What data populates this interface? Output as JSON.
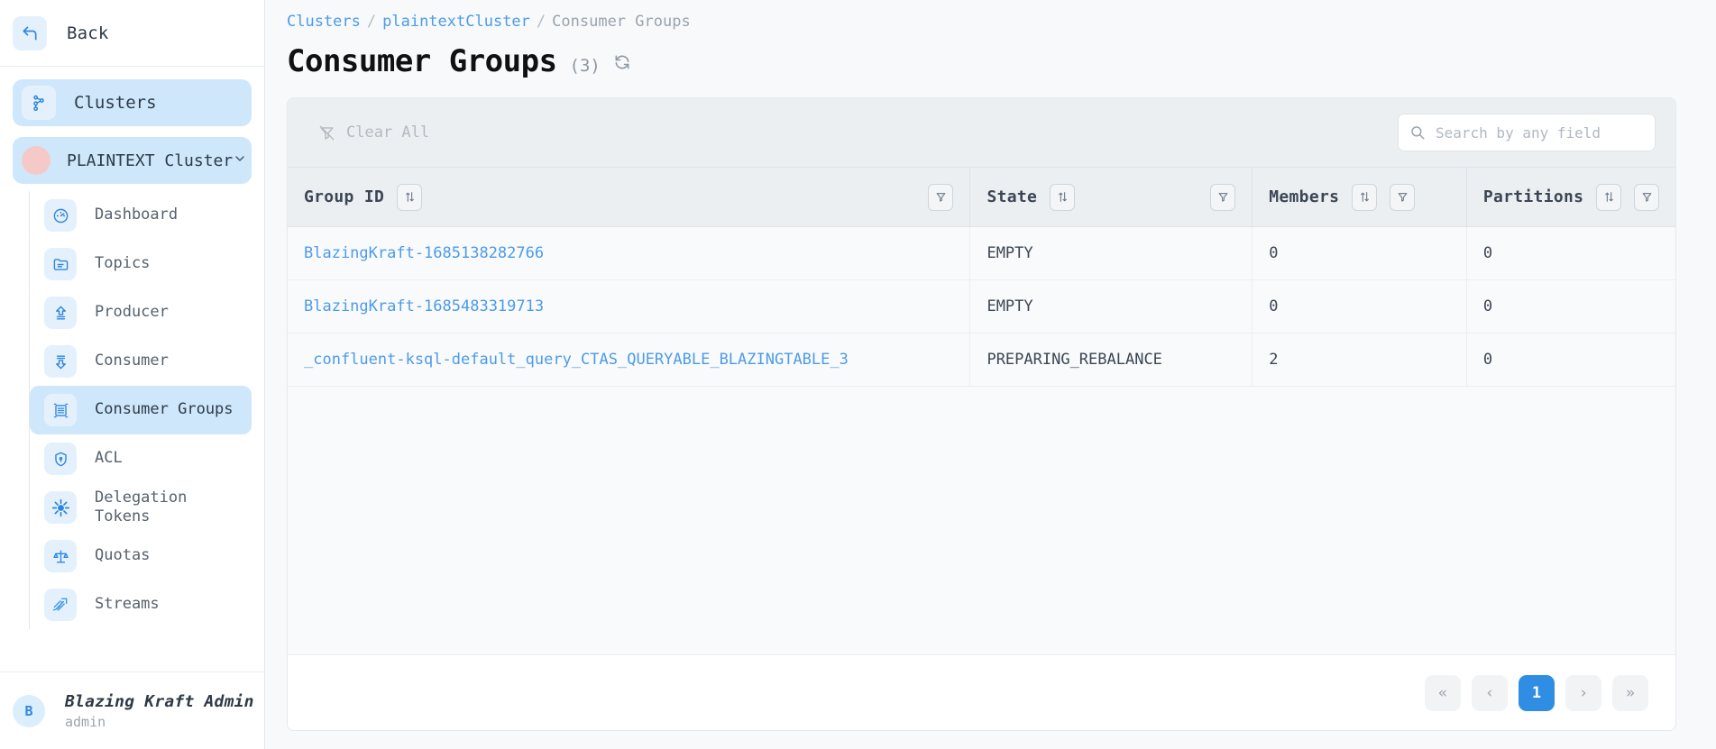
{
  "sidebar": {
    "back": {
      "label": "Back",
      "icon": "back-arrow-icon"
    },
    "clusters": {
      "label": "Clusters",
      "icon": "clusters-icon"
    },
    "cluster": {
      "label": "PLAINTEXT Cluster",
      "icon": "cluster-status-dot",
      "chevron": "⌄"
    },
    "items": [
      {
        "label": "Dashboard",
        "icon": "dashboard-icon",
        "active": false
      },
      {
        "label": "Topics",
        "icon": "topics-icon",
        "active": false
      },
      {
        "label": "Producer",
        "icon": "producer-icon",
        "active": false
      },
      {
        "label": "Consumer",
        "icon": "consumer-icon",
        "active": false
      },
      {
        "label": "Consumer Groups",
        "icon": "consumer-groups-icon",
        "active": true
      },
      {
        "label": "ACL",
        "icon": "shield-icon",
        "active": false
      },
      {
        "label": "Delegation\nTokens",
        "icon": "delegation-tokens-icon",
        "active": false
      },
      {
        "label": "Quotas",
        "icon": "scales-icon",
        "active": false
      },
      {
        "label": "Streams",
        "icon": "streams-icon",
        "active": false
      }
    ],
    "user": {
      "initial": "B",
      "name": "Blazing Kraft Admin",
      "role": "admin"
    }
  },
  "breadcrumb": {
    "items": [
      "Clusters",
      "plaintextCluster",
      "Consumer Groups"
    ],
    "separator": "/"
  },
  "header": {
    "title": "Consumer Groups",
    "count": "(3)",
    "refresh_icon": "refresh-icon"
  },
  "toolbar": {
    "clear_all_label": "Clear All",
    "clear_all_icon": "filter-off-icon",
    "search_icon": "search-icon",
    "search_placeholder": "Search by any field",
    "search_value": ""
  },
  "table": {
    "columns": [
      {
        "label": "Group ID",
        "sort_icon": "sort-icon",
        "filter_icon": "filter-icon",
        "has_spacer": true
      },
      {
        "label": "State",
        "sort_icon": "sort-icon",
        "filter_icon": "filter-icon",
        "has_spacer": true
      },
      {
        "label": "Members",
        "sort_icon": "sort-icon",
        "filter_icon": "filter-icon",
        "has_spacer": false
      },
      {
        "label": "Partitions",
        "sort_icon": "sort-icon",
        "filter_icon": "filter-icon",
        "has_spacer": false
      }
    ],
    "rows": [
      {
        "group_id": "BlazingKraft-1685138282766",
        "state": "EMPTY",
        "members": "0",
        "partitions": "0"
      },
      {
        "group_id": "BlazingKraft-1685483319713",
        "state": "EMPTY",
        "members": "0",
        "partitions": "0"
      },
      {
        "group_id": "_confluent-ksql-default_query_CTAS_QUERYABLE_BLAZINGTABLE_3",
        "state": "PREPARING_REBALANCE",
        "members": "2",
        "partitions": "0"
      }
    ]
  },
  "pagination": {
    "first": "«",
    "prev": "‹",
    "current_page": "1",
    "next": "›",
    "last": "»"
  },
  "colors": {
    "accent": "#2f8de4",
    "link": "#4d9bea",
    "active_nav_bg": "#cfe7fb",
    "icon_tile_bg": "#e4f1fd",
    "toolbar_bg": "#eceff2",
    "page_bg": "#f7f9fb",
    "cluster_dot": "#f6c9c9"
  }
}
